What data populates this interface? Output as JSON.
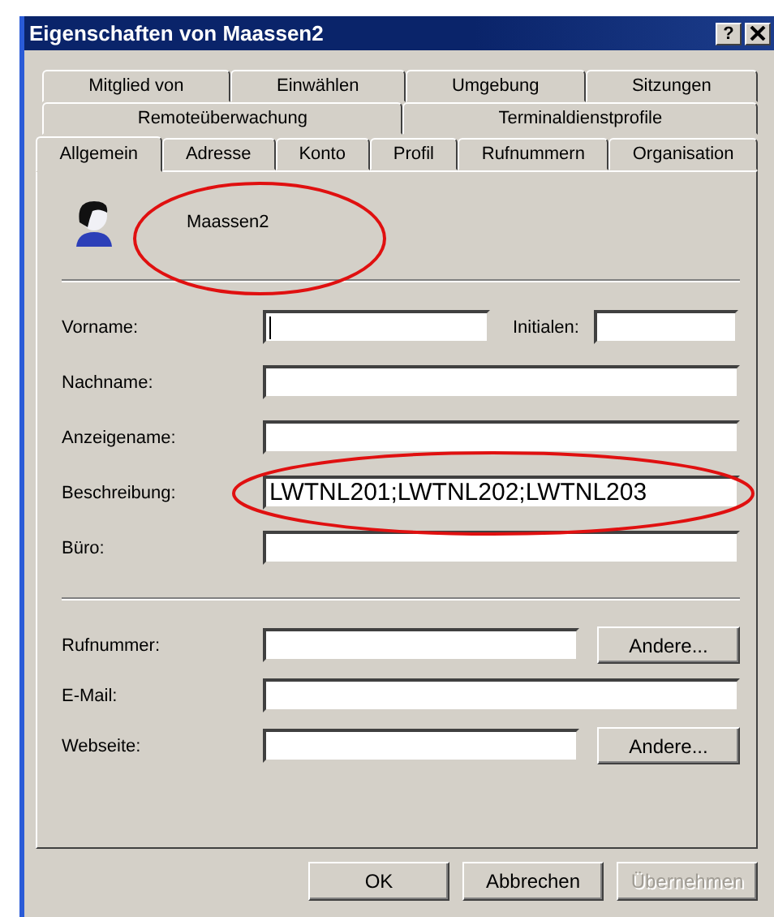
{
  "window": {
    "title": "Eigenschaften von Maassen2",
    "help_button": "?"
  },
  "tab_rows": [
    [
      {
        "label": "Mitglied von",
        "selected": false
      },
      {
        "label": "Einwählen",
        "selected": false
      },
      {
        "label": "Umgebung",
        "selected": false
      },
      {
        "label": "Sitzungen",
        "selected": false
      }
    ],
    [
      {
        "label": "Remoteüberwachung",
        "selected": false
      },
      {
        "label": "Terminaldienstprofile",
        "selected": false
      }
    ],
    [
      {
        "label": "Allgemein",
        "selected": true
      },
      {
        "label": "Adresse",
        "selected": false
      },
      {
        "label": "Konto",
        "selected": false
      },
      {
        "label": "Profil",
        "selected": false
      },
      {
        "label": "Rufnummern",
        "selected": false
      },
      {
        "label": "Organisation",
        "selected": false
      }
    ]
  ],
  "user": {
    "name": "Maassen2",
    "highlighted": true
  },
  "sections": [
    {
      "fields": [
        {
          "label": "Vorname:",
          "focused": true,
          "highlighted": false,
          "side_field": {
            "label": "Initialen:"
          }
        },
        {
          "label": "Nachname:",
          "focused": false,
          "highlighted": false
        },
        {
          "label": "Anzeigename:",
          "focused": false,
          "highlighted": false
        },
        {
          "label": "Beschreibung:",
          "value": "LWTNL201;LWTNL202;LWTNL203",
          "focused": false,
          "highlighted": true
        },
        {
          "label": "Büro:",
          "focused": false,
          "highlighted": false
        }
      ]
    },
    {
      "fields": [
        {
          "label": "Rufnummer:",
          "focused": false,
          "highlighted": false,
          "button": {
            "label": "Andere..."
          }
        },
        {
          "label": "E-Mail:",
          "focused": false,
          "highlighted": false
        },
        {
          "label": "Webseite:",
          "focused": false,
          "highlighted": false,
          "button": {
            "label": "Andere..."
          }
        }
      ]
    }
  ],
  "buttons": [
    {
      "label": "OK",
      "disabled": false
    },
    {
      "label": "Abbrechen",
      "disabled": false
    },
    {
      "label": "Übernehmen",
      "disabled": true
    }
  ]
}
